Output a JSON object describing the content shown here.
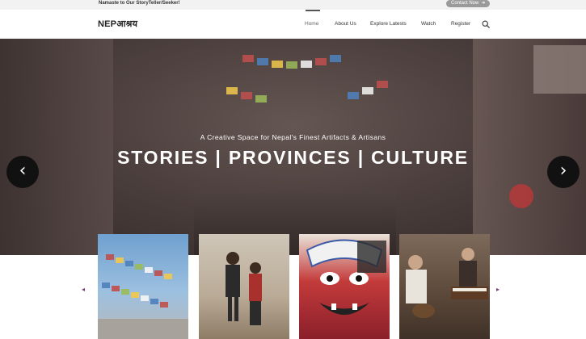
{
  "topbar": {
    "greeting": "Namaste to Our StoryTeller/Seeker!",
    "contact_label": "Contact Now",
    "contact_icon": "arrow-right-icon"
  },
  "header": {
    "logo": "NEPआश्रय",
    "nav": [
      "Home",
      "About Us",
      "Explore Latests",
      "Watch",
      "Register"
    ],
    "active": "Home",
    "search_icon": "search-icon"
  },
  "hero": {
    "subtitle": "A Creative Space for Nepal's Finest Artifacts & Artisans",
    "title": "STORIES | PROVINCES | CULTURE",
    "prev_icon": "‹",
    "next_icon": "›"
  },
  "carousel": {
    "prev_icon": "◂",
    "next_icon": "▸",
    "items": [
      {
        "subject": "prayer-flags-photo"
      },
      {
        "subject": "children-in-traditional-dress-photo"
      },
      {
        "subject": "bhairav-mask-painting-photo"
      },
      {
        "subject": "musicians-playing-instruments-photo"
      }
    ]
  },
  "colors": {
    "accent": "#7a3d7a",
    "dark_button": "#111111",
    "contact_bg": "#9a9a9a"
  }
}
